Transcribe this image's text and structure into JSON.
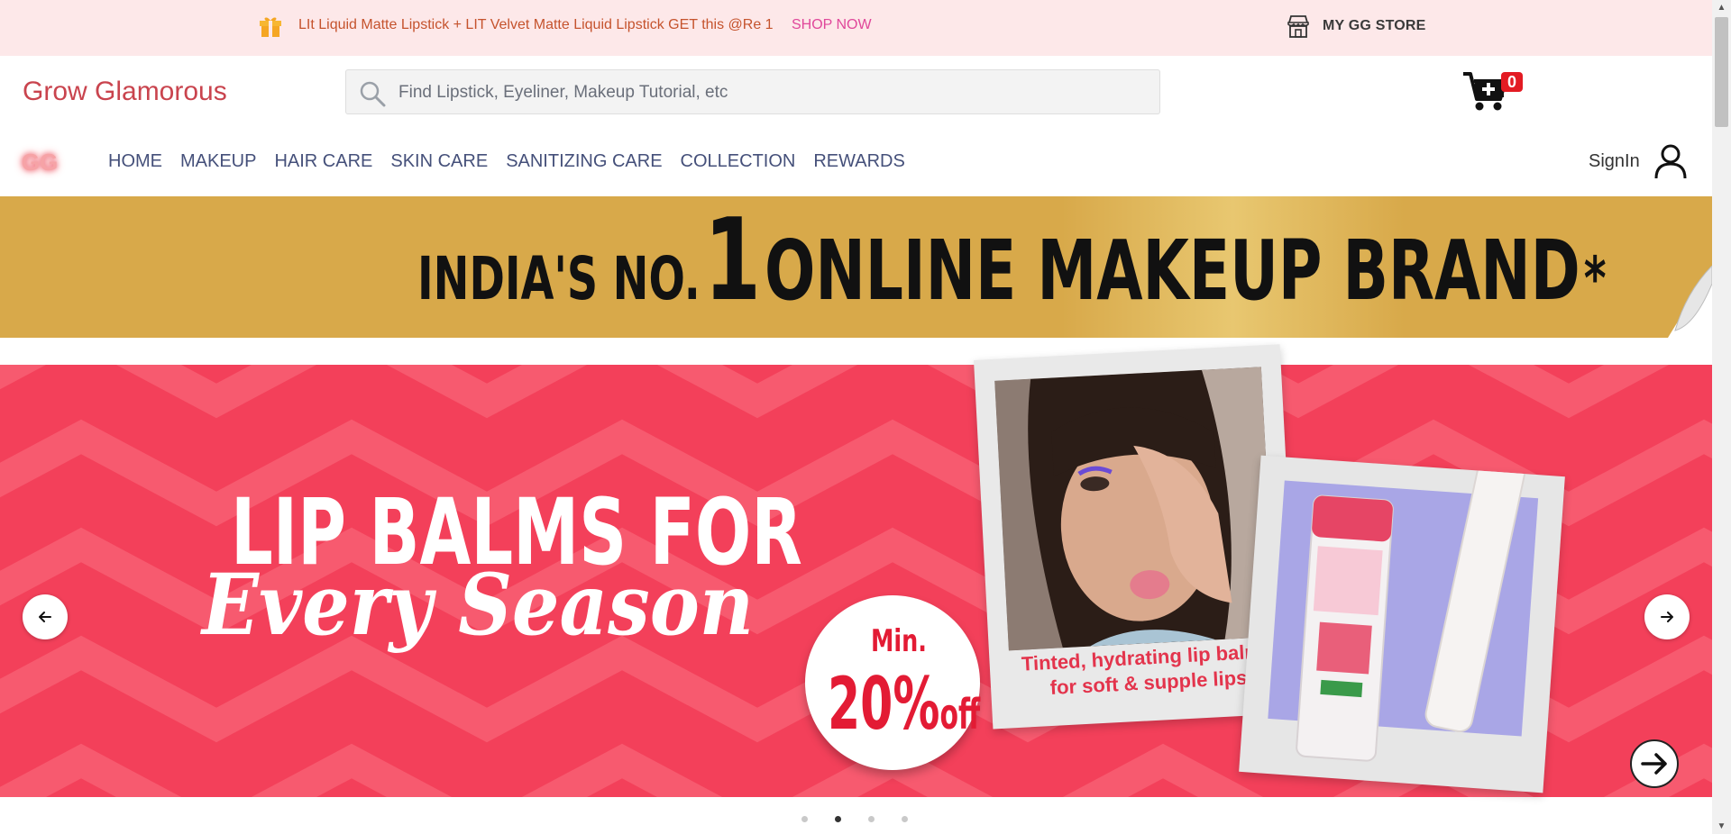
{
  "promo": {
    "text": "LIt Liquid Matte Lipstick + LIT Velvet Matte Liquid Lipstick GET this @Re 1",
    "cta": "SHOP NOW",
    "store_label": "MY GG STORE",
    "gift_icon": "gift-icon",
    "store_icon": "store-icon"
  },
  "header": {
    "brand": "Grow Glamorous",
    "search_placeholder": "Find Lipstick, Eyeliner, Makeup Tutorial, etc",
    "search_value": "",
    "cart_count": "0"
  },
  "nav": {
    "logo": "GG",
    "items": [
      "HOME",
      "MAKEUP",
      "HAIR CARE",
      "SKIN CARE",
      "SANITIZING CARE",
      "COLLECTION",
      "REWARDS"
    ],
    "signin": "SignIn"
  },
  "banner": {
    "part1": "INDIA'S NO.",
    "part2": "1",
    "part3": "ONLINE MAKEUP BRAND",
    "asterisk": "*"
  },
  "hero": {
    "title_line1": "LIP BALMS FOR",
    "title_line2": "Every Season",
    "discount_min": "Min.",
    "discount_value": "20%",
    "discount_off": "off",
    "caption": "Tinted, hydrating lip balms for soft & supple lips",
    "slides_total": 4,
    "active_slide": 2
  },
  "colors": {
    "promo_bg": "#fde8e9",
    "brand": "#c9444e",
    "nav_text": "#45507a",
    "gold": "#d8a94a",
    "hero_red": "#f3405a",
    "badge_red": "#e31b23",
    "cta_pink": "#e0479a"
  }
}
